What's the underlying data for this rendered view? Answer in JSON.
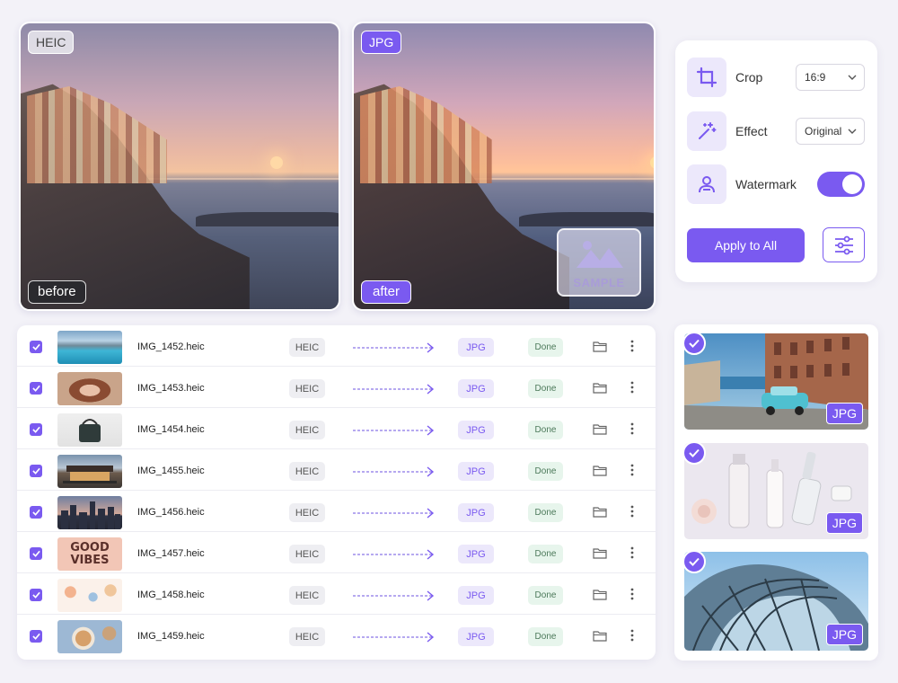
{
  "preview": {
    "before_format": "HEIC",
    "after_format": "JPG",
    "before_label": "before",
    "after_label": "after",
    "watermark_text": "SAMPLE"
  },
  "settings": {
    "crop": {
      "label": "Crop",
      "value": "16:9"
    },
    "effect": {
      "label": "Effect",
      "value": "Original"
    },
    "watermark": {
      "label": "Watermark",
      "enabled": true
    },
    "apply_label": "Apply to All"
  },
  "files": [
    {
      "name": "IMG_1452.heic",
      "from": "HEIC",
      "to": "JPG",
      "status": "Done",
      "checked": true,
      "thumb": "lake"
    },
    {
      "name": "IMG_1453.heic",
      "from": "HEIC",
      "to": "JPG",
      "status": "Done",
      "checked": true,
      "thumb": "portrait"
    },
    {
      "name": "IMG_1454.heic",
      "from": "HEIC",
      "to": "JPG",
      "status": "Done",
      "checked": true,
      "thumb": "handbag"
    },
    {
      "name": "IMG_1455.heic",
      "from": "HEIC",
      "to": "JPG",
      "status": "Done",
      "checked": true,
      "thumb": "house"
    },
    {
      "name": "IMG_1456.heic",
      "from": "HEIC",
      "to": "JPG",
      "status": "Done",
      "checked": true,
      "thumb": "skyline"
    },
    {
      "name": "IMG_1457.heic",
      "from": "HEIC",
      "to": "JPG",
      "status": "Done",
      "checked": true,
      "thumb": "good-vibes",
      "thumb_text": [
        "GOOD",
        "VIBES"
      ]
    },
    {
      "name": "IMG_1458.heic",
      "from": "HEIC",
      "to": "JPG",
      "status": "Done",
      "checked": true,
      "thumb": "flowers"
    },
    {
      "name": "IMG_1459.heic",
      "from": "HEIC",
      "to": "JPG",
      "status": "Done",
      "checked": true,
      "thumb": "food"
    }
  ],
  "gallery": [
    {
      "subject": "street-classic-car",
      "badge": "JPG",
      "checked": true
    },
    {
      "subject": "cosmetic-bottles",
      "badge": "JPG",
      "checked": true
    },
    {
      "subject": "glass-dome-building",
      "badge": "JPG",
      "checked": true
    }
  ],
  "colors": {
    "accent": "#7a5af0",
    "accent_light": "#ece8fb",
    "done_bg": "#e7f5ec"
  }
}
